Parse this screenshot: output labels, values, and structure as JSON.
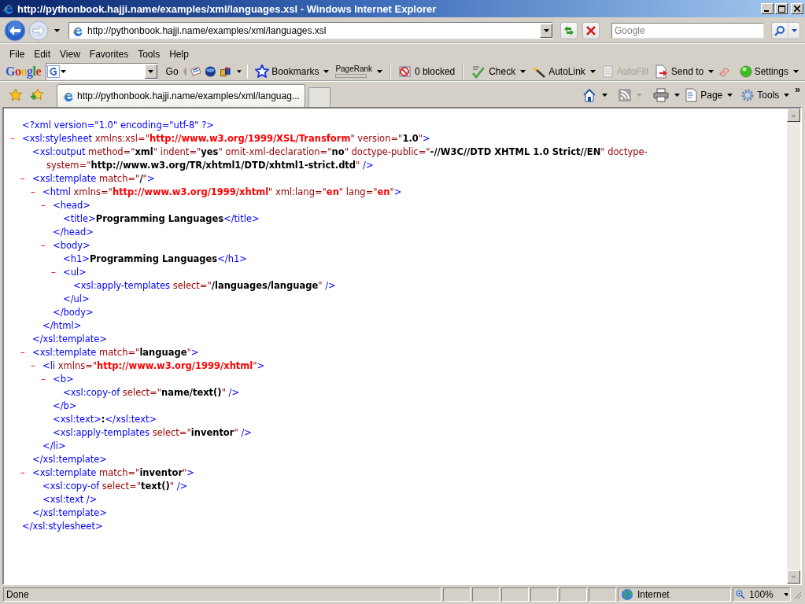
{
  "window": {
    "title": "http://pythonbook.hajji.name/examples/xml/languages.xsl - Windows Internet Explorer"
  },
  "address_bar": {
    "url": "http://pythonbook.hajji.name/examples/xml/languages.xsl"
  },
  "search_box": {
    "placeholder": "Google"
  },
  "menu": [
    "File",
    "Edit",
    "View",
    "Favorites",
    "Tools",
    "Help"
  ],
  "google_toolbar": {
    "logo": "Google",
    "go": "Go",
    "items": [
      {
        "label": "Bookmarks",
        "dropdown": true,
        "disabled": false
      },
      {
        "label": "PageRank",
        "dropdown": true,
        "disabled": false
      },
      {
        "label": "0 blocked",
        "dropdown": false,
        "disabled": false
      },
      {
        "label": "Check",
        "dropdown": true,
        "disabled": false
      },
      {
        "label": "AutoLink",
        "dropdown": true,
        "disabled": false
      },
      {
        "label": "AutoFill",
        "dropdown": false,
        "disabled": true
      },
      {
        "label": "Send to",
        "dropdown": true,
        "disabled": false
      },
      {
        "label": "Settings",
        "dropdown": true,
        "disabled": false
      }
    ]
  },
  "tabs": [
    {
      "label": "http://pythonbook.hajji.name/examples/xml/languag...",
      "selected": true
    }
  ],
  "command_bar": {
    "items": [
      {
        "label": "Page"
      },
      {
        "label": "Tools"
      }
    ],
    "chevron": "»"
  },
  "document": {
    "nodes": [
      {
        "open": [
          {
            "kind": "markup",
            "text": "<?xml version=\"1.0\" encoding=\"utf-8\" ?>"
          }
        ]
      },
      {
        "toggle": "–",
        "open": [
          {
            "kind": "markup",
            "text": "<xsl:stylesheet"
          },
          {
            "kind": "attr",
            "text": " xmlns:xsl=\""
          },
          {
            "kind": "ns",
            "text": "http://www.w3.org/1999/XSL/Transform"
          },
          {
            "kind": "attr",
            "text": "\" version=\""
          },
          {
            "kind": "value",
            "text": "1.0"
          },
          {
            "kind": "attr",
            "text": "\""
          },
          {
            "kind": "markup",
            "text": ">"
          }
        ],
        "children": [
          {
            "open": [
              {
                "kind": "markup",
                "text": "<xsl:output"
              },
              {
                "kind": "attr",
                "text": " method=\""
              },
              {
                "kind": "value",
                "text": "xml"
              },
              {
                "kind": "attr",
                "text": "\" indent=\""
              },
              {
                "kind": "value",
                "text": "yes"
              },
              {
                "kind": "attr",
                "text": "\" omit-xml-declaration=\""
              },
              {
                "kind": "value",
                "text": "no"
              },
              {
                "kind": "attr",
                "text": "\" doctype-public=\""
              },
              {
                "kind": "value",
                "text": "-//W3C//DTD XHTML 1.0 Strict//EN"
              },
              {
                "kind": "attr",
                "text": "\" doctype-system=\""
              },
              {
                "kind": "value",
                "text": "http://www.w3.org/TR/xhtml1/DTD/xhtml1-strict.dtd"
              },
              {
                "kind": "attr",
                "text": "\""
              },
              {
                "kind": "markup",
                "text": " />"
              }
            ]
          },
          {
            "toggle": "–",
            "open": [
              {
                "kind": "markup",
                "text": "<xsl:template"
              },
              {
                "kind": "attr",
                "text": " match=\""
              },
              {
                "kind": "value",
                "text": "/"
              },
              {
                "kind": "attr",
                "text": "\""
              },
              {
                "kind": "markup",
                "text": ">"
              }
            ],
            "children": [
              {
                "toggle": "–",
                "open": [
                  {
                    "kind": "markup",
                    "text": "<html"
                  },
                  {
                    "kind": "attr",
                    "text": " xmlns=\""
                  },
                  {
                    "kind": "ns",
                    "text": "http://www.w3.org/1999/xhtml"
                  },
                  {
                    "kind": "attr",
                    "text": "\" xml:lang=\""
                  },
                  {
                    "kind": "ns",
                    "text": "en"
                  },
                  {
                    "kind": "attr",
                    "text": "\" lang=\""
                  },
                  {
                    "kind": "ns",
                    "text": "en"
                  },
                  {
                    "kind": "attr",
                    "text": "\""
                  },
                  {
                    "kind": "markup",
                    "text": ">"
                  }
                ],
                "children": [
                  {
                    "toggle": "–",
                    "open": [
                      {
                        "kind": "markup",
                        "text": "<head>"
                      }
                    ],
                    "children": [
                      {
                        "open": [
                          {
                            "kind": "markup",
                            "text": "<title>"
                          },
                          {
                            "kind": "text",
                            "text": "Programming Languages"
                          },
                          {
                            "kind": "markup",
                            "text": "</title>"
                          }
                        ]
                      }
                    ],
                    "close": [
                      {
                        "kind": "markup",
                        "text": "</head>"
                      }
                    ]
                  },
                  {
                    "toggle": "–",
                    "open": [
                      {
                        "kind": "markup",
                        "text": "<body>"
                      }
                    ],
                    "children": [
                      {
                        "open": [
                          {
                            "kind": "markup",
                            "text": "<h1>"
                          },
                          {
                            "kind": "text",
                            "text": "Programming Languages"
                          },
                          {
                            "kind": "markup",
                            "text": "</h1>"
                          }
                        ]
                      },
                      {
                        "toggle": "–",
                        "open": [
                          {
                            "kind": "markup",
                            "text": "<ul>"
                          }
                        ],
                        "children": [
                          {
                            "open": [
                              {
                                "kind": "markup",
                                "text": "<xsl:apply-templates"
                              },
                              {
                                "kind": "attr",
                                "text": " select=\""
                              },
                              {
                                "kind": "value",
                                "text": "/languages/language"
                              },
                              {
                                "kind": "attr",
                                "text": "\""
                              },
                              {
                                "kind": "markup",
                                "text": " />"
                              }
                            ]
                          }
                        ],
                        "close": [
                          {
                            "kind": "markup",
                            "text": "</ul>"
                          }
                        ]
                      }
                    ],
                    "close": [
                      {
                        "kind": "markup",
                        "text": "</body>"
                      }
                    ]
                  }
                ],
                "close": [
                  {
                    "kind": "markup",
                    "text": "</html>"
                  }
                ]
              }
            ],
            "close": [
              {
                "kind": "markup",
                "text": "</xsl:template>"
              }
            ]
          },
          {
            "toggle": "–",
            "open": [
              {
                "kind": "markup",
                "text": "<xsl:template"
              },
              {
                "kind": "attr",
                "text": " match=\""
              },
              {
                "kind": "value",
                "text": "language"
              },
              {
                "kind": "attr",
                "text": "\""
              },
              {
                "kind": "markup",
                "text": ">"
              }
            ],
            "children": [
              {
                "toggle": "–",
                "open": [
                  {
                    "kind": "markup",
                    "text": "<li"
                  },
                  {
                    "kind": "attr",
                    "text": " xmlns=\""
                  },
                  {
                    "kind": "ns",
                    "text": "http://www.w3.org/1999/xhtml"
                  },
                  {
                    "kind": "attr",
                    "text": "\""
                  },
                  {
                    "kind": "markup",
                    "text": ">"
                  }
                ],
                "children": [
                  {
                    "toggle": "–",
                    "open": [
                      {
                        "kind": "markup",
                        "text": "<b>"
                      }
                    ],
                    "children": [
                      {
                        "open": [
                          {
                            "kind": "markup",
                            "text": "<xsl:copy-of"
                          },
                          {
                            "kind": "attr",
                            "text": " select=\""
                          },
                          {
                            "kind": "value",
                            "text": "name/text()"
                          },
                          {
                            "kind": "attr",
                            "text": "\""
                          },
                          {
                            "kind": "markup",
                            "text": " />"
                          }
                        ]
                      }
                    ],
                    "close": [
                      {
                        "kind": "markup",
                        "text": "</b>"
                      }
                    ]
                  },
                  {
                    "open": [
                      {
                        "kind": "markup",
                        "text": "<xsl:text>"
                      },
                      {
                        "kind": "text",
                        "text": ":"
                      },
                      {
                        "kind": "markup",
                        "text": "</xsl:text>"
                      }
                    ]
                  },
                  {
                    "open": [
                      {
                        "kind": "markup",
                        "text": "<xsl:apply-templates"
                      },
                      {
                        "kind": "attr",
                        "text": " select=\""
                      },
                      {
                        "kind": "value",
                        "text": "inventor"
                      },
                      {
                        "kind": "attr",
                        "text": "\""
                      },
                      {
                        "kind": "markup",
                        "text": " />"
                      }
                    ]
                  }
                ],
                "close": [
                  {
                    "kind": "markup",
                    "text": "</li>"
                  }
                ]
              }
            ],
            "close": [
              {
                "kind": "markup",
                "text": "</xsl:template>"
              }
            ]
          },
          {
            "toggle": "–",
            "open": [
              {
                "kind": "markup",
                "text": "<xsl:template"
              },
              {
                "kind": "attr",
                "text": " match=\""
              },
              {
                "kind": "value",
                "text": "inventor"
              },
              {
                "kind": "attr",
                "text": "\""
              },
              {
                "kind": "markup",
                "text": ">"
              }
            ],
            "children": [
              {
                "open": [
                  {
                    "kind": "markup",
                    "text": "<xsl:copy-of"
                  },
                  {
                    "kind": "attr",
                    "text": " select=\""
                  },
                  {
                    "kind": "value",
                    "text": "text()"
                  },
                  {
                    "kind": "attr",
                    "text": "\""
                  },
                  {
                    "kind": "markup",
                    "text": " />"
                  }
                ]
              },
              {
                "open": [
                  {
                    "kind": "markup",
                    "text": "<xsl:text />"
                  }
                ]
              }
            ],
            "close": [
              {
                "kind": "markup",
                "text": "</xsl:template>"
              }
            ]
          }
        ],
        "close": [
          {
            "kind": "markup",
            "text": "</xsl:stylesheet>"
          }
        ]
      }
    ]
  },
  "status_bar": {
    "text": "Done",
    "zone": "Internet",
    "zoom": "100%"
  }
}
